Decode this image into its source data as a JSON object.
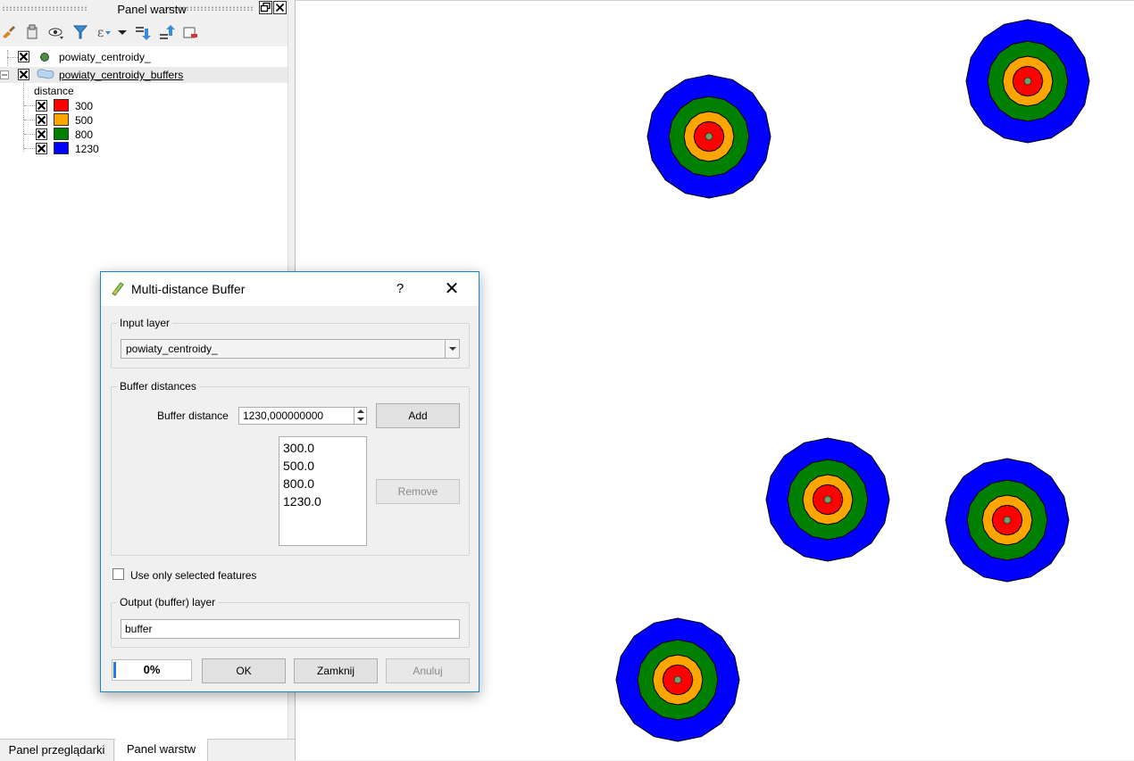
{
  "layers_panel": {
    "title": "Panel warstw",
    "layers": [
      {
        "name": "powiaty_centroidy_",
        "checked": true,
        "icon": "point-symbol-icon",
        "color": "#4f8a4a"
      },
      {
        "name": "powiaty_centroidy_buffers",
        "checked": true,
        "icon": "polygon-symbol-icon",
        "expanded": true,
        "classification_field": "distance",
        "classes": [
          {
            "label": "300",
            "color": "#ff0000"
          },
          {
            "label": "500",
            "color": "#ffa500"
          },
          {
            "label": "800",
            "color": "#008000"
          },
          {
            "label": "1230",
            "color": "#0000ff"
          }
        ]
      }
    ],
    "toolbar_icons": [
      "brush-icon",
      "add-group-icon",
      "eye-icon",
      "filter-icon",
      "expression-filter-icon",
      "dropdown-arrow-icon",
      "expand-all-icon",
      "collapse-all-icon",
      "remove-layer-icon"
    ]
  },
  "bottom_tabs": [
    {
      "label": "Panel przeglądarki",
      "active": false
    },
    {
      "label": "Panel warstw",
      "active": true
    }
  ],
  "dialog": {
    "title": "Multi-distance Buffer",
    "help_label": "?",
    "close_label": "✕",
    "input_layer": {
      "group_title": "Input layer",
      "value": "powiaty_centroidy_"
    },
    "buffer_distances": {
      "group_title": "Buffer distances",
      "distance_label": "Buffer distance",
      "distance_value": "1230,000000000",
      "add_label": "Add",
      "remove_label": "Remove",
      "list": [
        "300.0",
        "500.0",
        "800.0",
        "1230.0"
      ]
    },
    "use_selected_label": "Use only selected features",
    "use_selected_checked": false,
    "output": {
      "group_title": "Output (buffer) layer",
      "value": "buffer"
    },
    "progress": {
      "text": "0%",
      "value": 0
    },
    "ok_label": "OK",
    "close_button_label": "Zamknij",
    "cancel_label": "Anuluj"
  },
  "map": {
    "background": "#ffffff",
    "ring_colors": [
      "#0000ff",
      "#008000",
      "#ffa500",
      "#ff0000"
    ],
    "centroid_color": "#6e9e6e",
    "ring_radius_ratios": [
      1.0,
      0.6504,
      0.4065,
      0.2439
    ]
  }
}
